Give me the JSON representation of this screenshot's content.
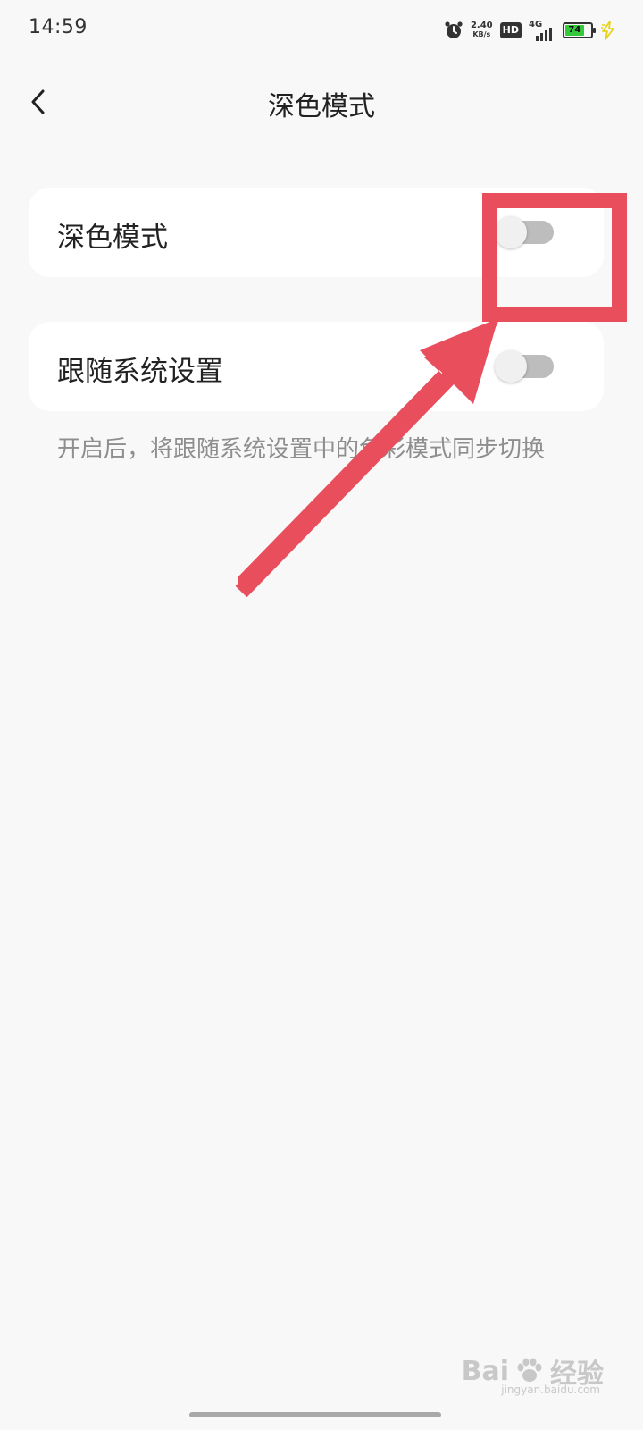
{
  "status_bar": {
    "time": "14:59",
    "net_speed": "2.40",
    "net_speed_unit": "KB/s",
    "hd_label": "HD",
    "network_type": "4G",
    "battery_level": "74",
    "battery_color": "#34c93a",
    "icons": [
      "alarm-icon",
      "hd-icon",
      "signal-icon",
      "battery-icon",
      "charging-icon"
    ]
  },
  "header": {
    "title": "深色模式",
    "back_icon": "chevron-left-icon"
  },
  "settings": {
    "items": [
      {
        "label": "深色模式",
        "toggle_on": false
      },
      {
        "label": "跟随系统设置",
        "toggle_on": false
      }
    ],
    "note": "开启后，将跟随系统设置中的色彩模式同步切换"
  },
  "annotation": {
    "color": "#e94e5d"
  },
  "watermark": {
    "brand": "Bai",
    "brand_suffix": "经验",
    "url": "jingyan.baidu.com"
  }
}
